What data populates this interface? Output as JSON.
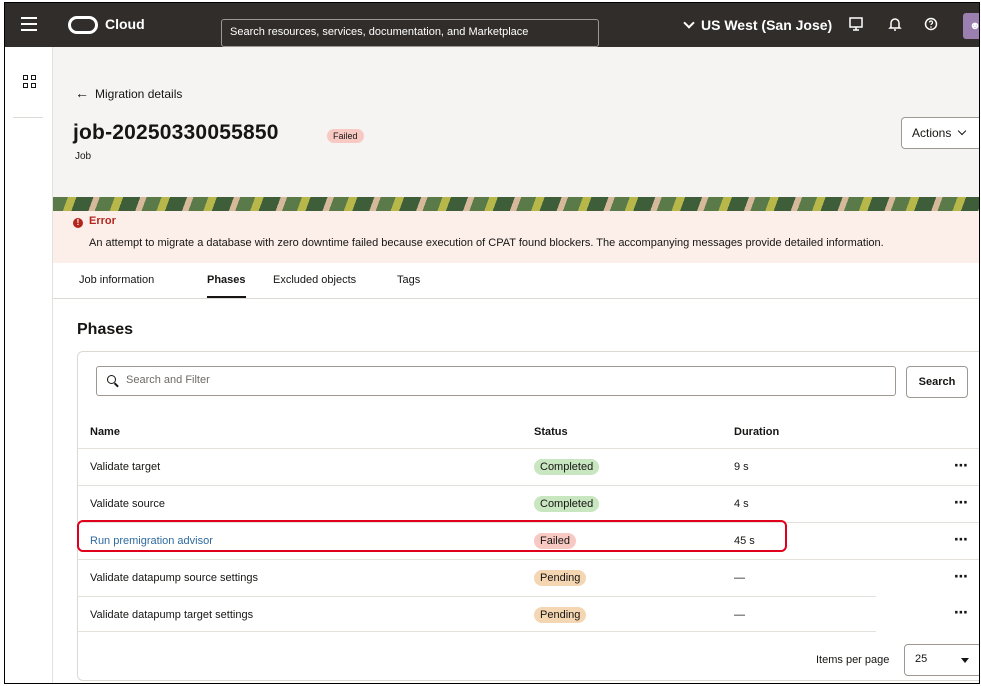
{
  "topbar": {
    "brand": "Cloud",
    "search_placeholder": "Search resources, services, documentation, and Marketplace",
    "region": "US West (San Jose)"
  },
  "header": {
    "back_label": "Migration details",
    "job_name": "job-20250330055850",
    "job_status": "Failed",
    "job_type": "Job",
    "actions_label": "Actions"
  },
  "error": {
    "title": "Error",
    "message": "An attempt to migrate a database with zero downtime failed because execution of CPAT found blockers. The accompanying messages provide detailed information."
  },
  "tabs": [
    "Job information",
    "Phases",
    "Excluded objects",
    "Tags"
  ],
  "active_tab": "Phases",
  "phases": {
    "title": "Phases",
    "filter_placeholder": "Search and Filter",
    "search_button": "Search",
    "columns": [
      "Name",
      "Status",
      "Duration"
    ],
    "rows": [
      {
        "name": "Validate target",
        "status": "Completed",
        "duration": "9 s"
      },
      {
        "name": "Validate source",
        "status": "Completed",
        "duration": "4 s"
      },
      {
        "name": "Run premigration advisor",
        "status": "Failed",
        "duration": "45 s"
      },
      {
        "name": "Validate datapump source settings",
        "status": "Pending",
        "duration": "—"
      },
      {
        "name": "Validate datapump target settings",
        "status": "Pending",
        "duration": "—"
      }
    ],
    "items_per_page_label": "Items per page",
    "items_per_page": "25"
  },
  "colors": {
    "topbar": "#312d2a",
    "failed": "#f8c8c2",
    "completed": "#c8e6c0",
    "pending": "#f5d6b3",
    "link": "#2e6b9e",
    "highlight": "#e0001b"
  }
}
